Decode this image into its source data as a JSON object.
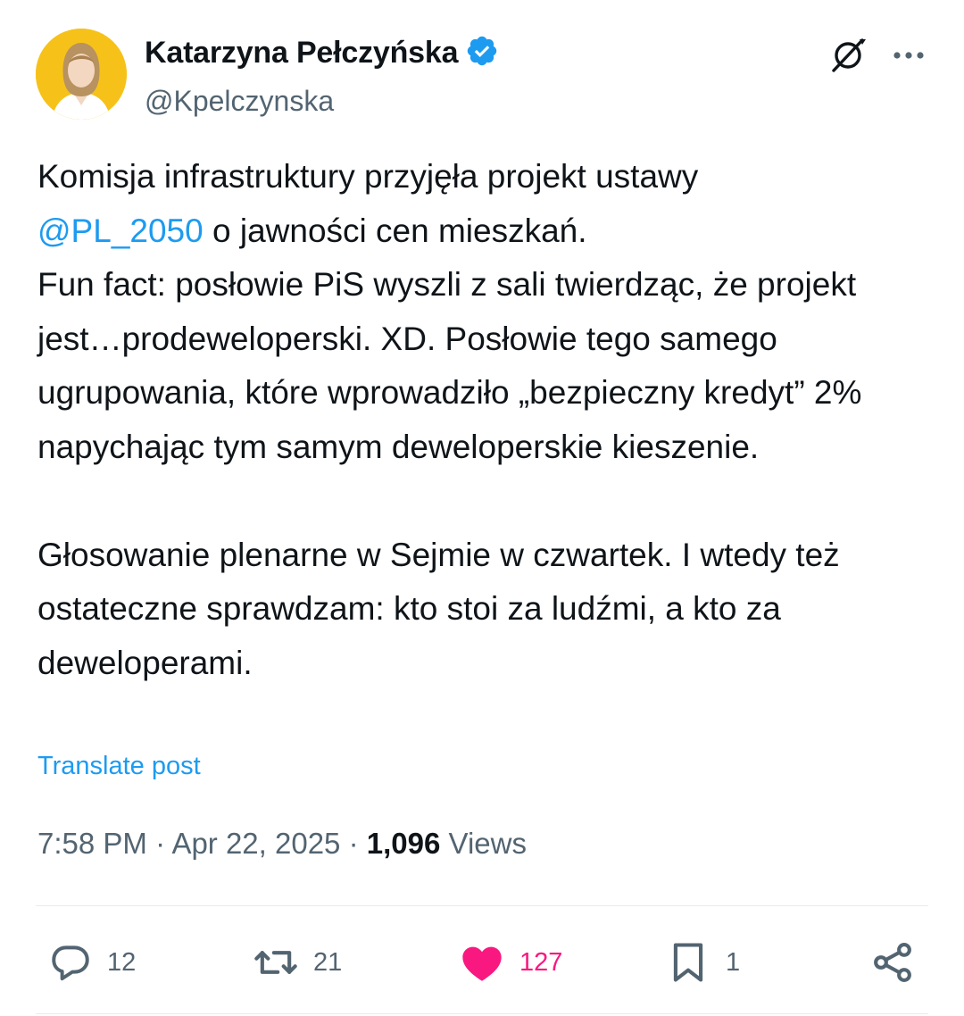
{
  "author": {
    "name": "Katarzyna Pełczyńska",
    "handle": "@Kpelczynska",
    "verified": true
  },
  "icons": {
    "verified": "verified-badge-icon",
    "grok": "grok-icon",
    "more": "more-icon",
    "reply": "reply-icon",
    "repost": "repost-icon",
    "like": "heart-icon",
    "bookmark": "bookmark-icon",
    "share": "share-icon"
  },
  "colors": {
    "accent": "#1d9bf0",
    "like": "#f91880",
    "muted": "#536471",
    "text": "#0f1419",
    "avatar_bg": "#f6c21a"
  },
  "tweet": {
    "line1": "Komisja infrastruktury przyjęła projekt ustawy",
    "mention": "@PL_2050",
    "line2_rest": " o jawności cen mieszkań.",
    "para2": "Fun fact: posłowie PiS wyszli z sali twierdząc, że projekt jest…prodeweloperski. XD. Posłowie tego samego ugrupowania, które wprowadziło „bezpieczny kredyt”  2% napychając tym samym deweloperskie kieszenie.",
    "para3": "Głosowanie plenarne w Sejmie w czwartek. I wtedy też ostateczne sprawdzam: kto stoi za ludźmi, a kto za deweloperami."
  },
  "translate_label": "Translate post",
  "meta": {
    "time": "7:58 PM",
    "separator": "·",
    "date": "Apr 22, 2025",
    "views_count": "1,096",
    "views_label": "Views"
  },
  "actions": {
    "replies": "12",
    "reposts": "21",
    "likes": "127",
    "bookmarks": "1",
    "liked": true
  }
}
